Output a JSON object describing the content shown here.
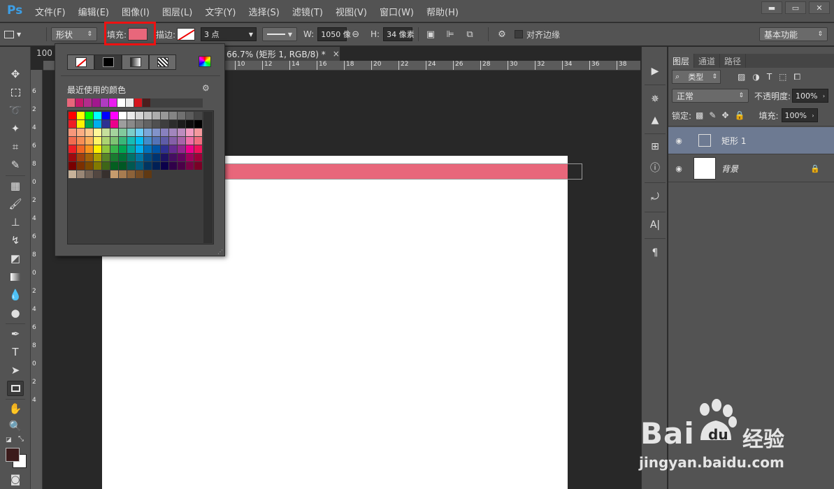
{
  "app": {
    "logo": "Ps",
    "menu": [
      "文件(F)",
      "编辑(E)",
      "图像(I)",
      "图层(L)",
      "文字(Y)",
      "选择(S)",
      "滤镜(T)",
      "视图(V)",
      "窗口(W)",
      "帮助(H)"
    ],
    "window_controls": {
      "minimize": "▬",
      "restore": "▭",
      "close": "✕"
    }
  },
  "options": {
    "mode": "形状",
    "fill_label": "填充:",
    "fill_color": "#e8677b",
    "stroke_label": "描边:",
    "stroke_width": "3 点",
    "width_label": "W:",
    "width_value": "1050 像",
    "height_label": "H:",
    "height_value": "34 像素",
    "align_edges": "对齐边缘",
    "workspace": "基本功能"
  },
  "document": {
    "zoom_label": "100",
    "tab_title": "66.7% (矩形 1, RGB/8) *",
    "tab_close": "×",
    "shape_color": "#e8677b",
    "hruler_ticks": [
      "10",
      "12",
      "14",
      "16",
      "18",
      "20",
      "22",
      "24",
      "26",
      "28",
      "30",
      "32",
      "34",
      "36",
      "38"
    ],
    "vruler_ticks": [
      "6",
      "2",
      "4",
      "6",
      "8",
      "0",
      "2",
      "4",
      "6",
      "8",
      "0",
      "2",
      "4",
      "6",
      "8",
      "0",
      "2",
      "4"
    ]
  },
  "color_popup": {
    "recent_title": "最近使用的颜色",
    "recent_colors": [
      "#e8677b",
      "#c61a6a",
      "#b32c8c",
      "#a2178e",
      "#b03bc1",
      "#ea1cef",
      "#ffffff",
      "#e9e9e9",
      "#d4151e",
      "#4a1e1e",
      "#404040",
      "#404040",
      "#404040",
      "#404040",
      "#404040",
      "#404040"
    ],
    "swatches": [
      "#ff0000",
      "#ffff00",
      "#00ff00",
      "#00ffff",
      "#0000ff",
      "#ff00ff",
      "#ffffff",
      "#ebebeb",
      "#d6d6d6",
      "#c2c2c2",
      "#adadad",
      "#999999",
      "#858585",
      "#707070",
      "#5c5c5c",
      "#474747",
      "#ee1c24",
      "#fff200",
      "#00a651",
      "#00aeef",
      "#2e3192",
      "#ec008c",
      "#9e9e9e",
      "#8a8a8a",
      "#767676",
      "#636363",
      "#505050",
      "#3e3e3e",
      "#2c2c2c",
      "#1c1c1c",
      "#0d0d0d",
      "#000000",
      "#f7977a",
      "#fbad82",
      "#fdc68c",
      "#fff799",
      "#c6df9c",
      "#a4d49d",
      "#81ca9d",
      "#7bcdc9",
      "#6ccff7",
      "#7ca6d8",
      "#8293ca",
      "#8881be",
      "#a286bd",
      "#bc8cbf",
      "#f49bc1",
      "#f5999d",
      "#f26c4f",
      "#f68e55",
      "#fbaf5a",
      "#fff467",
      "#acd372",
      "#7dc473",
      "#39b778",
      "#16bcb4",
      "#00bff3",
      "#438ccb",
      "#5573b7",
      "#5e5ca7",
      "#855fa8",
      "#a763a9",
      "#ef6ea8",
      "#f16d7e",
      "#ee1d24",
      "#f16522",
      "#f7941d",
      "#fff100",
      "#8fc63d",
      "#37b44a",
      "#00a650",
      "#00a99e",
      "#00aeef",
      "#0072bc",
      "#0054a5",
      "#2f3192",
      "#652c91",
      "#91278f",
      "#ec008c",
      "#ee105a",
      "#9d0a0f",
      "#a1410d",
      "#a36209",
      "#aba000",
      "#588528",
      "#197b30",
      "#007236",
      "#00736a",
      "#0076a4",
      "#004a80",
      "#003370",
      "#1d1363",
      "#450e61",
      "#62055f",
      "#9e005c",
      "#9d0039",
      "#790000",
      "#7b3000",
      "#7c4900",
      "#827a00",
      "#3e6617",
      "#045f20",
      "#005824",
      "#005951",
      "#005b7e",
      "#003562",
      "#002056",
      "#0c004b",
      "#30004a",
      "#4b0048",
      "#7a0045",
      "#7a0026",
      "#c7b299",
      "#998675",
      "#736357",
      "#534741",
      "#37302d",
      "#c69c6d",
      "#a77c50",
      "#8c6239",
      "#754c24",
      "#603913"
    ]
  },
  "layers_panel": {
    "tabs": [
      "图层",
      "通道",
      "路径"
    ],
    "filter": "类型",
    "blend_mode": "正常",
    "opacity_label": "不透明度:",
    "opacity_value": "100%",
    "lock_label": "锁定:",
    "fill_label": "填充:",
    "fill_value": "100%",
    "layers": [
      {
        "name": "矩形 1",
        "selected": true
      },
      {
        "name": "背景",
        "selected": false
      }
    ]
  },
  "watermark": {
    "brand": "Bai",
    "brand_suffix": "du",
    "cn": "经验",
    "url": "jingyan.baidu.com"
  }
}
